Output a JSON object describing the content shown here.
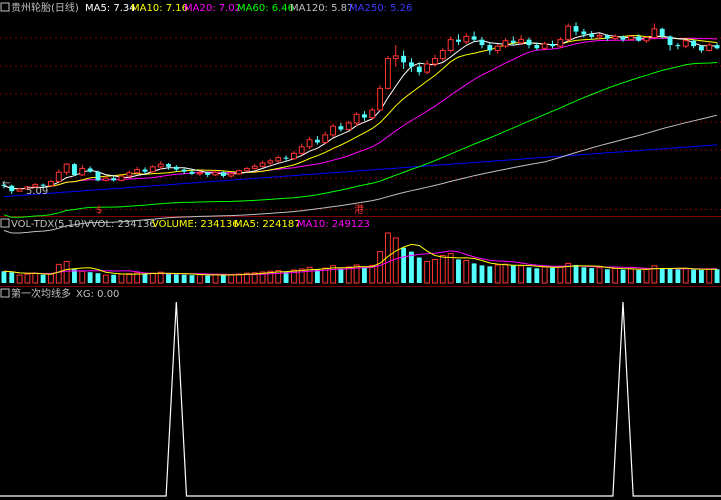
{
  "colors": {
    "bg": "#000000",
    "grid": "#800000",
    "up": "#ff3333",
    "down": "#54ffff",
    "ma5": "#ffffff",
    "ma10": "#ffff00",
    "ma20": "#ff00ff",
    "ma60": "#00ff00",
    "ma120": "#c0c0c0",
    "ma250": "#0000ff",
    "label": "#c0c0c0",
    "marker": "#ff3333",
    "signal": "#ffffff"
  },
  "price_panel": {
    "title": "贵州轮胎(日线)",
    "ma5_label": "MA5: 7.34",
    "ma10_label": "MA10: 7.16",
    "ma20_label": "MA20: 7.02",
    "ma60_label": "MA60: 6.46",
    "ma120_label": "MA120: 5.87",
    "ma250_label": "MA250: 5.26",
    "low_label": "5.09",
    "markers": [
      "$",
      "港"
    ]
  },
  "volume_panel": {
    "title": "VOL-TDX(5,10)",
    "vvol_label": "VVOL: 234136",
    "volume_label": "VOLUME: 234136",
    "ma5_label": "MA5: 224187",
    "ma10_label": "MA10: 249123"
  },
  "signal_panel": {
    "title": "第一次均线多",
    "xg_label": "XG: 0.00"
  },
  "chart_data": {
    "type": "candlestick",
    "price_range": [
      4.9,
      8.3
    ],
    "candles": [
      [
        5.22,
        5.2,
        5.26,
        5.15
      ],
      [
        5.2,
        5.1,
        5.22,
        5.05
      ],
      [
        5.1,
        5.14,
        5.16,
        5.09
      ],
      [
        5.14,
        5.18,
        5.2,
        5.12
      ],
      [
        5.18,
        5.22,
        5.25,
        5.16
      ],
      [
        5.22,
        5.2,
        5.24,
        5.17
      ],
      [
        5.2,
        5.28,
        5.3,
        5.18
      ],
      [
        5.28,
        5.45,
        5.5,
        5.26
      ],
      [
        5.45,
        5.6,
        5.62,
        5.4
      ],
      [
        5.6,
        5.4,
        5.62,
        5.38
      ],
      [
        5.4,
        5.52,
        5.58,
        5.38
      ],
      [
        5.52,
        5.46,
        5.56,
        5.44
      ],
      [
        5.46,
        5.3,
        5.48,
        5.28
      ],
      [
        5.3,
        5.34,
        5.38,
        5.28
      ],
      [
        5.34,
        5.3,
        5.38,
        5.28
      ],
      [
        5.3,
        5.38,
        5.4,
        5.28
      ],
      [
        5.38,
        5.44,
        5.48,
        5.34
      ],
      [
        5.44,
        5.5,
        5.55,
        5.42
      ],
      [
        5.5,
        5.46,
        5.54,
        5.42
      ],
      [
        5.46,
        5.55,
        5.58,
        5.44
      ],
      [
        5.55,
        5.6,
        5.65,
        5.5
      ],
      [
        5.6,
        5.55,
        5.62,
        5.5
      ],
      [
        5.55,
        5.5,
        5.58,
        5.46
      ],
      [
        5.5,
        5.46,
        5.52,
        5.42
      ],
      [
        5.46,
        5.42,
        5.5,
        5.4
      ],
      [
        5.42,
        5.44,
        5.48,
        5.38
      ],
      [
        5.44,
        5.4,
        5.46,
        5.36
      ],
      [
        5.4,
        5.45,
        5.48,
        5.38
      ],
      [
        5.45,
        5.38,
        5.47,
        5.35
      ],
      [
        5.38,
        5.42,
        5.44,
        5.36
      ],
      [
        5.42,
        5.48,
        5.5,
        5.4
      ],
      [
        5.48,
        5.52,
        5.55,
        5.46
      ],
      [
        5.52,
        5.56,
        5.6,
        5.5
      ],
      [
        5.56,
        5.62,
        5.66,
        5.54
      ],
      [
        5.62,
        5.66,
        5.7,
        5.58
      ],
      [
        5.66,
        5.72,
        5.76,
        5.62
      ],
      [
        5.72,
        5.7,
        5.76,
        5.66
      ],
      [
        5.7,
        5.8,
        5.84,
        5.68
      ],
      [
        5.8,
        5.92,
        5.98,
        5.76
      ],
      [
        5.92,
        6.05,
        6.1,
        5.88
      ],
      [
        6.05,
        6.0,
        6.12,
        5.96
      ],
      [
        6.0,
        6.14,
        6.2,
        5.98
      ],
      [
        6.14,
        6.3,
        6.35,
        6.1
      ],
      [
        6.3,
        6.24,
        6.36,
        6.2
      ],
      [
        6.24,
        6.36,
        6.4,
        6.22
      ],
      [
        6.36,
        6.52,
        6.56,
        6.3
      ],
      [
        6.52,
        6.46,
        6.58,
        6.4
      ],
      [
        6.46,
        6.6,
        6.64,
        6.42
      ],
      [
        6.6,
        7.0,
        7.06,
        6.58
      ],
      [
        7.0,
        7.55,
        7.6,
        6.98
      ],
      [
        7.55,
        7.6,
        7.8,
        7.4
      ],
      [
        7.6,
        7.48,
        7.7,
        7.36
      ],
      [
        7.48,
        7.4,
        7.56,
        7.3
      ],
      [
        7.4,
        7.3,
        7.48,
        7.24
      ],
      [
        7.3,
        7.45,
        7.52,
        7.26
      ],
      [
        7.45,
        7.55,
        7.62,
        7.4
      ],
      [
        7.55,
        7.7,
        7.75,
        7.5
      ],
      [
        7.7,
        7.9,
        7.96,
        7.66
      ],
      [
        7.9,
        7.86,
        8.0,
        7.8
      ],
      [
        7.86,
        7.96,
        8.02,
        7.82
      ],
      [
        7.96,
        7.9,
        8.05,
        7.86
      ],
      [
        7.9,
        7.8,
        7.95,
        7.74
      ],
      [
        7.8,
        7.7,
        7.84,
        7.62
      ],
      [
        7.7,
        7.78,
        7.82,
        7.64
      ],
      [
        7.78,
        7.88,
        7.92,
        7.74
      ],
      [
        7.88,
        7.84,
        7.96,
        7.8
      ],
      [
        7.84,
        7.9,
        7.98,
        7.8
      ],
      [
        7.9,
        7.8,
        7.94,
        7.74
      ],
      [
        7.8,
        7.74,
        7.84,
        7.7
      ],
      [
        7.74,
        7.82,
        7.86,
        7.7
      ],
      [
        7.82,
        7.78,
        7.88,
        7.74
      ],
      [
        7.78,
        7.9,
        7.95,
        7.74
      ],
      [
        7.9,
        8.15,
        8.2,
        7.86
      ],
      [
        8.15,
        8.05,
        8.22,
        7.98
      ],
      [
        8.05,
        8.0,
        8.1,
        7.94
      ],
      [
        8.0,
        7.95,
        8.06,
        7.9
      ],
      [
        7.95,
        7.98,
        8.02,
        7.9
      ],
      [
        7.98,
        7.92,
        8.0,
        7.88
      ],
      [
        7.92,
        7.96,
        8.0,
        7.88
      ],
      [
        7.96,
        7.9,
        7.98,
        7.86
      ],
      [
        7.9,
        7.96,
        7.98,
        7.88
      ],
      [
        7.96,
        7.88,
        8.0,
        7.86
      ],
      [
        7.88,
        7.94,
        7.96,
        7.84
      ],
      [
        7.94,
        8.1,
        8.2,
        7.9
      ],
      [
        8.1,
        7.96,
        8.12,
        7.92
      ],
      [
        7.96,
        7.8,
        7.98,
        7.7
      ],
      [
        7.8,
        7.78,
        7.84,
        7.72
      ],
      [
        7.78,
        7.88,
        7.9,
        7.74
      ],
      [
        7.88,
        7.78,
        7.9,
        7.74
      ],
      [
        7.78,
        7.7,
        7.8,
        7.66
      ],
      [
        7.7,
        7.8,
        7.84,
        7.68
      ],
      [
        7.8,
        7.74,
        7.84,
        7.72
      ]
    ],
    "volume": [
      60,
      55,
      40,
      45,
      50,
      42,
      48,
      95,
      110,
      70,
      60,
      55,
      50,
      40,
      42,
      45,
      48,
      52,
      46,
      50,
      55,
      48,
      44,
      42,
      40,
      42,
      38,
      44,
      40,
      42,
      46,
      50,
      52,
      56,
      60,
      64,
      58,
      66,
      72,
      80,
      70,
      76,
      88,
      74,
      82,
      92,
      80,
      90,
      160,
      255,
      230,
      180,
      160,
      130,
      110,
      120,
      140,
      150,
      120,
      115,
      100,
      90,
      85,
      92,
      96,
      90,
      88,
      80,
      75,
      82,
      78,
      85,
      100,
      92,
      80,
      76,
      78,
      70,
      74,
      68,
      72,
      66,
      70,
      88,
      75,
      72,
      70,
      74,
      68,
      66,
      72,
      70
    ],
    "signal_peaks": [
      22,
      79
    ]
  }
}
